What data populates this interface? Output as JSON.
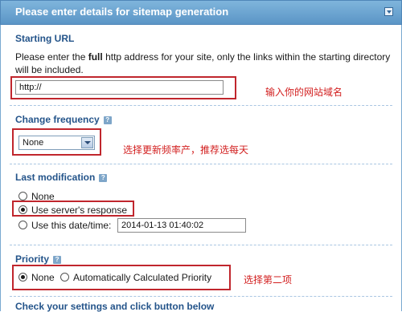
{
  "header": {
    "title": "Please enter details for sitemap generation"
  },
  "starting_url": {
    "title": "Starting URL",
    "description_before": "Please enter the ",
    "description_bold": "full",
    "description_after": " http address for your site, only the links within the starting directory will be included.",
    "input_value": "http://",
    "annotation": "输入你的网站域名"
  },
  "change_frequency": {
    "title": "Change frequency",
    "selected": "None",
    "annotation": "选择更新频率产，推荐选每天"
  },
  "last_modification": {
    "title": "Last modification",
    "options": [
      "None",
      "Use server's response",
      "Use this date/time:"
    ],
    "selected_index": 1,
    "datetime_value": "2014-01-13 01:40:02"
  },
  "priority": {
    "title": "Priority",
    "options": [
      "None",
      "Automatically Calculated Priority"
    ],
    "selected_index": 0,
    "annotation": "选择第二项"
  },
  "footer": {
    "title": "Check your settings and click button below"
  },
  "help_glyph": "?"
}
